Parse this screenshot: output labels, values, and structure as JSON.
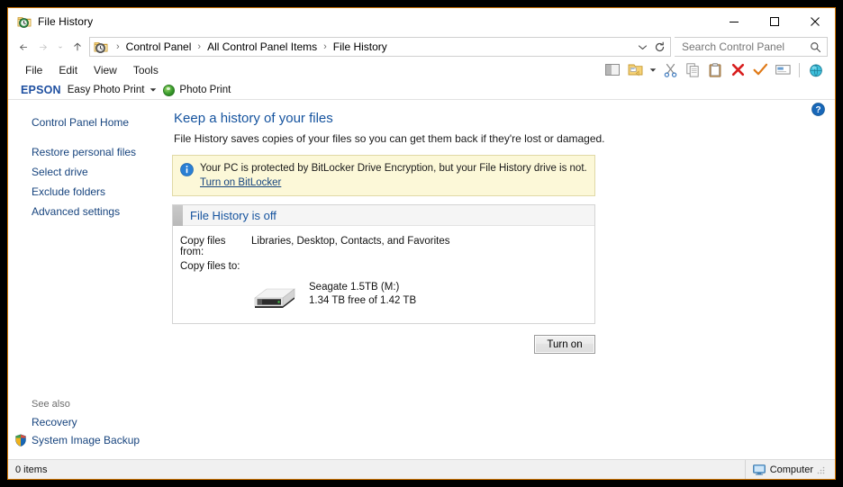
{
  "window": {
    "title": "File History",
    "icon": "file-history-folder-clock-icon",
    "controls": {
      "minimize": "—",
      "maximize": "☐",
      "close": "✕"
    }
  },
  "nav": {
    "back": "back-arrow",
    "forward": "forward-arrow",
    "recent": "chevron-down",
    "up": "up-arrow",
    "breadcrumbs": [
      "Control Panel",
      "All Control Panel Items",
      "File History"
    ],
    "separator": "›",
    "dropdown": "⌄",
    "refresh": "↻"
  },
  "search": {
    "placeholder": "Search Control Panel",
    "value": "",
    "icon": "search-icon"
  },
  "menu": {
    "items": [
      "File",
      "Edit",
      "View",
      "Tools"
    ]
  },
  "toolbar": {
    "icons": [
      "preview-pane-icon",
      "organize-folder-icon",
      "cut-scissors-icon",
      "copy-icon",
      "paste-icon",
      "delete-x-icon",
      "confirm-check-icon",
      "rename-icon",
      "globe-icon"
    ]
  },
  "epson": {
    "logo": "EPSON",
    "menu_label": "Easy Photo Print",
    "caret": "▾",
    "photo_print": "Photo Print",
    "photo_print_icon": "epson-green-circle-icon"
  },
  "sidebar": {
    "home": "Control Panel Home",
    "items": [
      "Restore personal files",
      "Select drive",
      "Exclude folders",
      "Advanced settings"
    ],
    "see_also_title": "See also",
    "see_also": [
      {
        "label": "Recovery",
        "icon": ""
      },
      {
        "label": "System Image Backup",
        "icon": "uac-shield-icon"
      }
    ]
  },
  "content": {
    "help_icon": "help-question-icon",
    "title": "Keep a history of your files",
    "subtitle": "File History saves copies of your files so you can get them back if they're lost or damaged.",
    "warning": {
      "icon": "info-icon",
      "text": "Your PC is protected by BitLocker Drive Encryption, but your File History drive is not.",
      "link": "Turn on BitLocker"
    },
    "panel": {
      "status_title": "File History is off",
      "copy_from_label": "Copy files from:",
      "copy_from_value": "Libraries, Desktop, Contacts, and Favorites",
      "copy_to_label": "Copy files to:",
      "drive_icon": "external-hard-drive-icon",
      "drive_name": "Seagate 1.5TB (M:)",
      "drive_space": "1.34 TB free of 1.42 TB"
    },
    "turn_on_button": "Turn on"
  },
  "statusbar": {
    "items_count": "0 items",
    "location_icon": "computer-monitor-icon",
    "location": "Computer"
  },
  "colors": {
    "window_border": "#d77800",
    "link": "#17447e",
    "heading": "#15539e",
    "warning_bg": "#fcf8d8",
    "epson_blue": "#1e4fa0"
  }
}
